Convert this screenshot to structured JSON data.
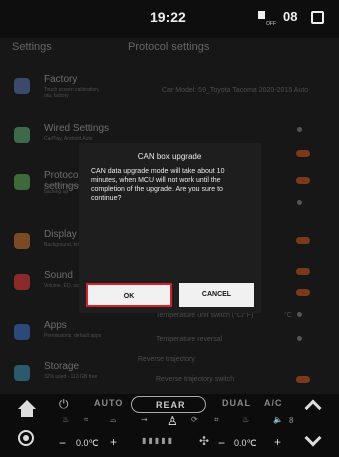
{
  "status": {
    "clock": "19:22",
    "volume": "08",
    "volume_sub": "OFF"
  },
  "background": {
    "sidebar_title": "Settings",
    "section_title": "Protocol settings",
    "sidebar_items": [
      {
        "label": "Factory",
        "sub": "Touch screen calibration, ota, factory",
        "color": "#3a4a6a"
      },
      {
        "label": "Wired Settings",
        "sub": "CarPlay, Android Auto",
        "color": "#3b6b4a"
      },
      {
        "label": "Protocol settings",
        "sub": "Car type, air conditioning, backing up",
        "color": "#3d6a3a"
      },
      {
        "label": "Display",
        "sub": "Background, brightness",
        "color": "#7a4a22"
      },
      {
        "label": "Sound",
        "sub": "Volume, EQ, sound",
        "color": "#8a2a2a"
      },
      {
        "label": "Apps",
        "sub": "Permissions, default apps",
        "color": "#2b4a7a"
      },
      {
        "label": "Storage",
        "sub": "32% used - 113 GB free",
        "color": "#2b5a6a"
      }
    ],
    "right_rows": [
      "Car Model: 59_Toyota Tacoma 2020-2015 Auto",
      "Temperature unit switch (°C/°F)",
      "Temperature reversal",
      "Reverse trajectory",
      "Reverse trajectory switch"
    ],
    "temp_unit": "°C"
  },
  "dialog": {
    "title": "CAN box upgrade",
    "message": "CAN data upgrade mode will take about 10 minutes, when MCU will not work until the completion of the upgrade. Are you sure to continue?",
    "ok_label": "OK",
    "cancel_label": "CANCEL"
  },
  "climate": {
    "auto_label": "AUTO",
    "rear_label": "REAR",
    "dual_label": "DUAL",
    "ac_label": "A/C",
    "left_temp": "0.0℃",
    "right_temp": "0.0℃",
    "fan_level": "8"
  }
}
